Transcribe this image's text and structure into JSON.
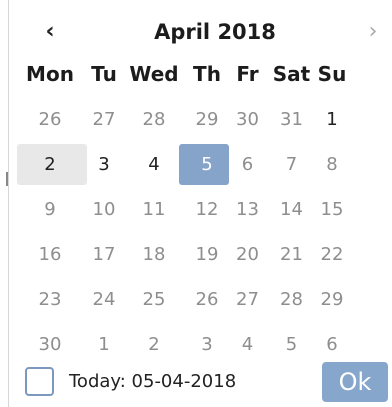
{
  "header": {
    "prev_icon": "chevron-left-icon",
    "prev_glyph": "‹",
    "next_icon": "chevron-right-icon",
    "next_glyph": "›",
    "title": "April 2018"
  },
  "weekdays": [
    "Mon",
    "Tu",
    "Wed",
    "Th",
    "Fr",
    "Sat",
    "Su"
  ],
  "weeks": [
    [
      {
        "label": "26",
        "state": "muted"
      },
      {
        "label": "27",
        "state": "muted"
      },
      {
        "label": "28",
        "state": "muted"
      },
      {
        "label": "29",
        "state": "muted"
      },
      {
        "label": "30",
        "state": "muted"
      },
      {
        "label": "31",
        "state": "muted"
      },
      {
        "label": "1",
        "state": "normal"
      }
    ],
    [
      {
        "label": "2",
        "state": "hover"
      },
      {
        "label": "3",
        "state": "normal"
      },
      {
        "label": "4",
        "state": "normal"
      },
      {
        "label": "5",
        "state": "selected"
      },
      {
        "label": "6",
        "state": "muted"
      },
      {
        "label": "7",
        "state": "muted"
      },
      {
        "label": "8",
        "state": "muted"
      }
    ],
    [
      {
        "label": "9",
        "state": "muted"
      },
      {
        "label": "10",
        "state": "muted"
      },
      {
        "label": "11",
        "state": "muted"
      },
      {
        "label": "12",
        "state": "muted"
      },
      {
        "label": "13",
        "state": "muted"
      },
      {
        "label": "14",
        "state": "muted"
      },
      {
        "label": "15",
        "state": "muted"
      }
    ],
    [
      {
        "label": "16",
        "state": "muted"
      },
      {
        "label": "17",
        "state": "muted"
      },
      {
        "label": "18",
        "state": "muted"
      },
      {
        "label": "19",
        "state": "muted"
      },
      {
        "label": "20",
        "state": "muted"
      },
      {
        "label": "21",
        "state": "muted"
      },
      {
        "label": "22",
        "state": "muted"
      }
    ],
    [
      {
        "label": "23",
        "state": "muted"
      },
      {
        "label": "24",
        "state": "muted"
      },
      {
        "label": "25",
        "state": "muted"
      },
      {
        "label": "26",
        "state": "muted"
      },
      {
        "label": "27",
        "state": "muted"
      },
      {
        "label": "28",
        "state": "muted"
      },
      {
        "label": "29",
        "state": "muted"
      }
    ],
    [
      {
        "label": "30",
        "state": "muted"
      },
      {
        "label": "1",
        "state": "muted"
      },
      {
        "label": "2",
        "state": "muted"
      },
      {
        "label": "3",
        "state": "muted"
      },
      {
        "label": "4",
        "state": "muted"
      },
      {
        "label": "5",
        "state": "muted"
      },
      {
        "label": "6",
        "state": "muted"
      }
    ]
  ],
  "footer": {
    "today_checked": false,
    "today_text": "Today: 05-04-2018",
    "ok_label": "Ok"
  },
  "colors": {
    "selected_bg": "#86a4c9",
    "hover_bg": "#e8e8e8",
    "muted_text": "#8e8e8e",
    "ok_bg": "#87a6cc",
    "checkbox_border": "#7d98bf"
  }
}
